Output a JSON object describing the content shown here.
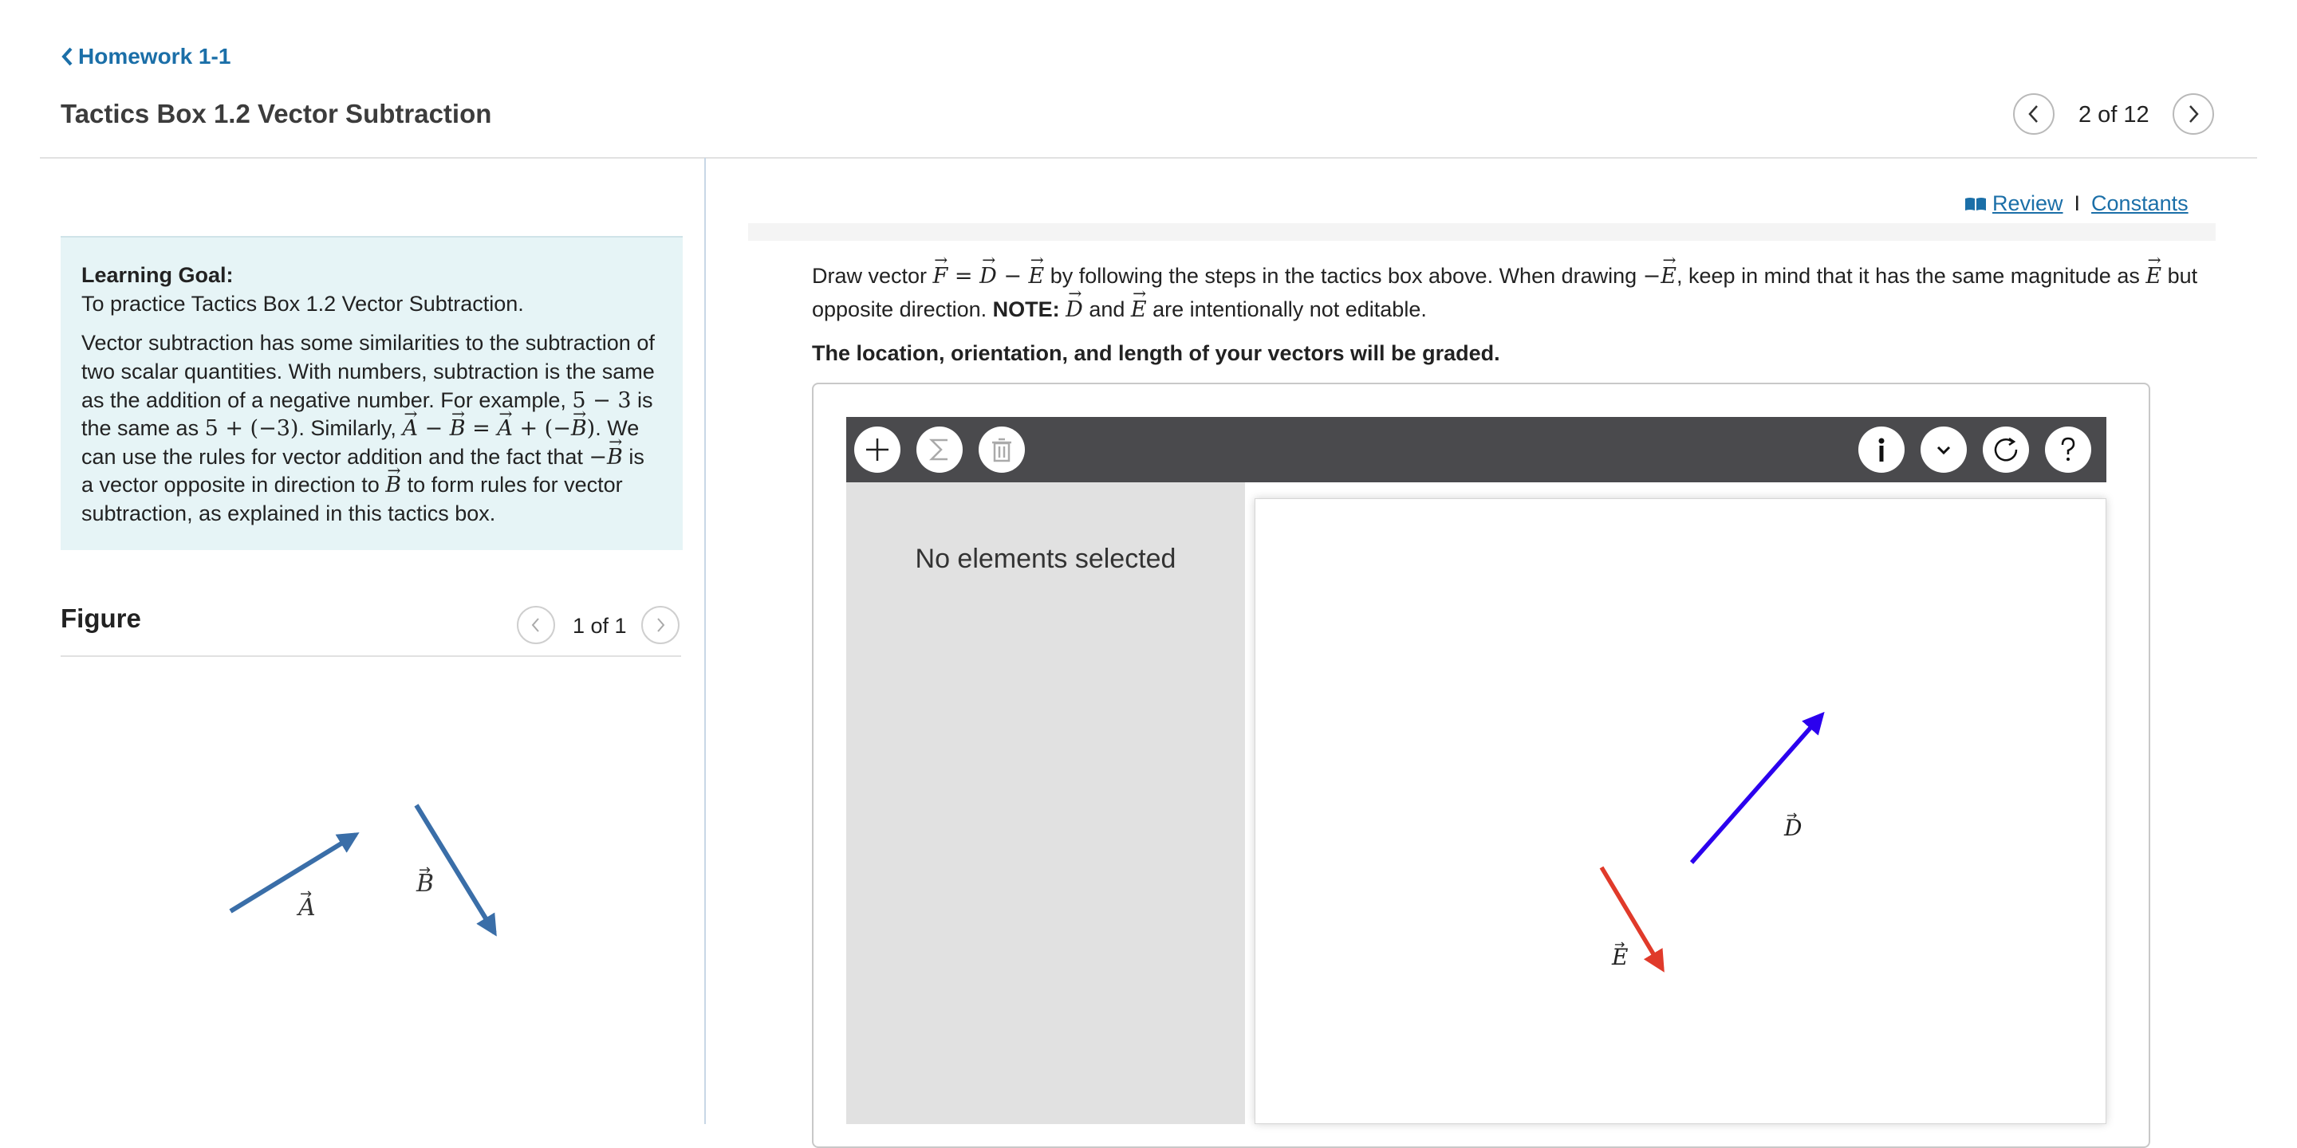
{
  "header": {
    "back_label": "Homework 1-1",
    "title": "Tactics Box 1.2 Vector Subtraction",
    "counter": "2 of 12",
    "icons": {
      "back": "chevron-left-icon",
      "prev": "chevron-left-icon",
      "next": "chevron-right-icon"
    }
  },
  "learning_goal": {
    "heading": "Learning Goal:",
    "goal": "To practice Tactics Box 1.2 Vector Subtraction.",
    "body": {
      "t1": "Vector subtraction has some similarities to the subtraction of two scalar quantities. With numbers, subtraction is the same as the addition of a negative number. For example, ",
      "m1": "5 − 3",
      "t2": " is the same as ",
      "m2": "5 + (−3)",
      "t3": ". Similarly, ",
      "m3a": "A",
      "m3op1": " − ",
      "m3b": "B",
      "m3op2": " = ",
      "m3c": "A",
      "m3op3": " + (−",
      "m3d": "B",
      "m3op4": ")",
      "t4": ". We can use the rules for vector addition and the fact that ",
      "m4op": "−",
      "m4": "B",
      "t5": " is a vector opposite in direction to ",
      "m5": "B",
      "t6": " to form rules for vector subtraction, as explained in this tactics box."
    }
  },
  "figure": {
    "title": "Figure",
    "counter": "1 of 1",
    "vector_a_label": "A",
    "vector_b_label": "B",
    "vector_color": "#3a6ea8"
  },
  "resources": {
    "review": "Review",
    "separator": "I",
    "constants": "Constants",
    "review_icon": "book-icon"
  },
  "instructions": {
    "t1": "Draw vector ",
    "f": "F",
    "eq": " = ",
    "d1": "D",
    "minus": " − ",
    "e1": "E",
    "t2": " by following the steps in the tactics box above. When drawing ",
    "neg": "−",
    "e2": "E",
    "t3": ", keep in mind that it has the same magnitude as ",
    "e3": "E",
    "t4": " but opposite direction. ",
    "note_label": "NOTE:",
    "t5": " ",
    "d2": "D",
    "t6": " and ",
    "e4": "E",
    "t7": " are intentionally not editable.",
    "graded": "The location, orientation, and length of your vectors will be graded."
  },
  "drawing_tool": {
    "tools": [
      "add-icon",
      "sigma-icon",
      "trash-icon"
    ],
    "right_tools": [
      "info-icon",
      "chevron-down-icon",
      "reset-icon",
      "help-icon"
    ],
    "side_panel_text": "No elements selected",
    "vector_d_label": "D",
    "vector_e_label": "E",
    "vector_d_color": "#2b00ee",
    "vector_e_color": "#e03a2a"
  }
}
